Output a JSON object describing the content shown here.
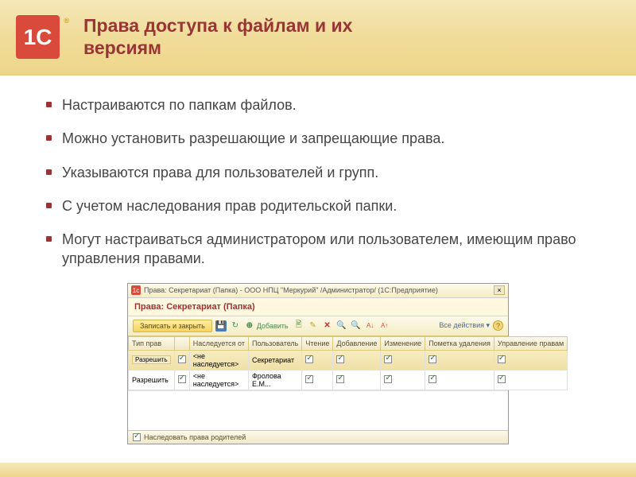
{
  "slide": {
    "logo_text": "1C",
    "logo_reg": "®",
    "title": "Права доступа к файлам и их версиям",
    "bullets": [
      "Настраиваются по папкам файлов.",
      "Можно установить разрешающие и запрещающие права.",
      "Указываются права для пользователей и групп.",
      "С учетом наследования прав родительской папки.",
      "Могут настраиваться администратором или пользователем, имеющим право управления правами."
    ]
  },
  "window": {
    "titlebar": "Права: Секретариат (Папка) - ООО НПЦ \"Меркурий\" /Администратор/  (1С:Предприятие)",
    "close": "×",
    "subtitle": "Права: Секретариат (Папка)",
    "toolbar": {
      "save_close": "Записать и закрыть",
      "add": "Добавить",
      "actions": "Все действия ▾",
      "help": "?"
    },
    "columns": [
      "Тип прав",
      "",
      "Наследуется от",
      "Пользователь",
      "Чтение",
      "Добавление",
      "Изменение",
      "Пометка удаления",
      "Управление правам"
    ],
    "rows": [
      {
        "type": "Разрешить",
        "inherit_chk": true,
        "inherit_from": "<не наследуется>",
        "user": "Секретариат",
        "read": true,
        "add": true,
        "edit": true,
        "del": true,
        "manage": true,
        "sel": true
      },
      {
        "type": "Разрешить",
        "inherit_chk": true,
        "inherit_from": "<не наследуется>",
        "user": "Фролова Е.М...",
        "read": true,
        "add": true,
        "edit": true,
        "del": true,
        "manage": true,
        "sel": false
      }
    ],
    "footer_chk": true,
    "footer_text": "Наследовать права родителей"
  }
}
